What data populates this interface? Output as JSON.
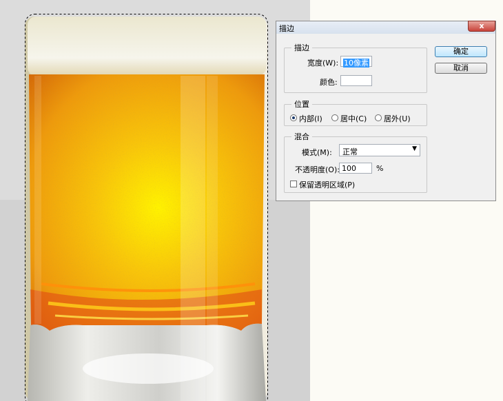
{
  "dialog": {
    "title": "描边",
    "close_symbol": "x",
    "stroke_group": {
      "legend": "描边",
      "width_label": "宽度(W):",
      "width_value": "10像素",
      "color_label": "颜色:",
      "color_value": "#ffffff"
    },
    "position_group": {
      "legend": "位置",
      "options": [
        "内部(I)",
        "居中(C)",
        "居外(U)"
      ],
      "selected": "内部(I)"
    },
    "blend_group": {
      "legend": "混合",
      "mode_label": "模式(M):",
      "mode_value": "正常",
      "opacity_label": "不透明度(O):",
      "opacity_value": "100",
      "opacity_unit": "%",
      "preserve_label": "保留透明区域(P)",
      "preserve_checked": false
    },
    "ok_label": "确定",
    "cancel_label": "取消"
  },
  "colors": {
    "beer_center": "#ffef00",
    "beer_mid": "#f4a70a",
    "beer_edge": "#d56a08",
    "foam": "#f0eedd"
  }
}
